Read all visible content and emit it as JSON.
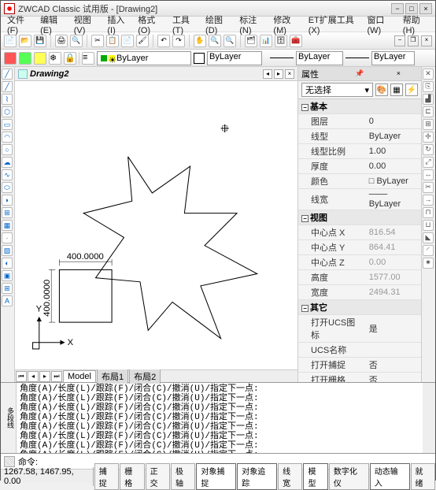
{
  "title": "ZWCAD Classic 试用版 - [Drawing2]",
  "menus": [
    "文件(F)",
    "编辑(E)",
    "视图(V)",
    "插入(I)",
    "格式(O)",
    "工具(T)",
    "绘图(D)",
    "标注(N)",
    "修改(M)",
    "ET扩展工具(X)",
    "窗口(W)",
    "帮助(H)"
  ],
  "doc_tab": "Drawing2",
  "layer_combo": "ByLayer",
  "linetype_combo": "ByLayer",
  "lineweight_combo": "ByLayer",
  "dim_label": "400.0000",
  "dim_label_v": "400.0000",
  "model_tabs": [
    "Model",
    "布局1",
    "布局2"
  ],
  "cmd_lines": [
    "角度(A)/长度(L)/跟踪(F)/闭合(C)/撤消(U)/指定下一点:",
    "角度(A)/长度(L)/跟踪(F)/闭合(C)/撤消(U)/指定下一点:",
    "角度(A)/长度(L)/跟踪(F)/闭合(C)/撤消(U)/指定下一点:",
    "角度(A)/长度(L)/跟踪(F)/闭合(C)/撤消(U)/指定下一点:",
    "角度(A)/长度(L)/跟踪(F)/闭合(C)/撤消(U)/指定下一点:",
    "角度(A)/长度(L)/跟踪(F)/闭合(C)/撤消(U)/指定下一点:",
    "角度(A)/长度(L)/跟踪(F)/闭合(C)/撤消(U)/指定下一点:",
    "角度(A)/长度(L)/跟踪(F)/闭合(C)/撤消(U)/指定下一点:",
    "角度(A)/长度(L)/跟踪(F)/闭合(C)/撤消(U)/指定下一点:",
    "角度(A)/长度(L)/跟踪(F)/闭合(C)/撤消(U)/指定下一点:",
    "角度(A)/长度(L)/跟踪(F)/闭合(C)/撤消(U)/指定下一点:",
    "角度(A)/长度(L)/跟踪(F)/闭合(C)/撤消(U)/指定下一点:",
    "角度(A)/长度(L)/跟踪(F)/闭合(C)/撤消(U)/指定下一点:",
    "角度(A)/长度(L)/跟踪(F)/闭合(C)/撤消(U)/指定下一点:"
  ],
  "cmd_prompt": "命令:",
  "cmd_side": "多段线",
  "coords": "1267.58, 1467.95, 0.00",
  "status_btns": [
    "捕捉",
    "栅格",
    "正交",
    "极轴",
    "对象捕捉",
    "对象追踪",
    "线宽",
    "模型",
    "数字化仪",
    "动态输入",
    "就绪"
  ],
  "prop": {
    "title": "属性",
    "selection": "无选择",
    "cat1": "基本",
    "rows1": [
      {
        "k": "图层",
        "v": "0"
      },
      {
        "k": "线型",
        "v": "ByLayer"
      },
      {
        "k": "线型比例",
        "v": "1.00"
      },
      {
        "k": "厚度",
        "v": "0.00"
      },
      {
        "k": "颜色",
        "v": "□ ByLayer"
      },
      {
        "k": "线宽",
        "v": "─── ByLayer"
      }
    ],
    "cat2": "视图",
    "rows2": [
      {
        "k": "中心点 X",
        "v": "816.54",
        "g": true
      },
      {
        "k": "中心点 Y",
        "v": "864.41",
        "g": true
      },
      {
        "k": "中心点 Z",
        "v": "0.00",
        "g": true
      },
      {
        "k": "高度",
        "v": "1577.00",
        "g": true
      },
      {
        "k": "宽度",
        "v": "2494.31",
        "g": true
      }
    ],
    "cat3": "其它",
    "rows3": [
      {
        "k": "打开UCS图标",
        "v": "是"
      },
      {
        "k": "UCS名称",
        "v": ""
      },
      {
        "k": "打开捕捉",
        "v": "否"
      },
      {
        "k": "打开栅格",
        "v": "否"
      }
    ]
  }
}
